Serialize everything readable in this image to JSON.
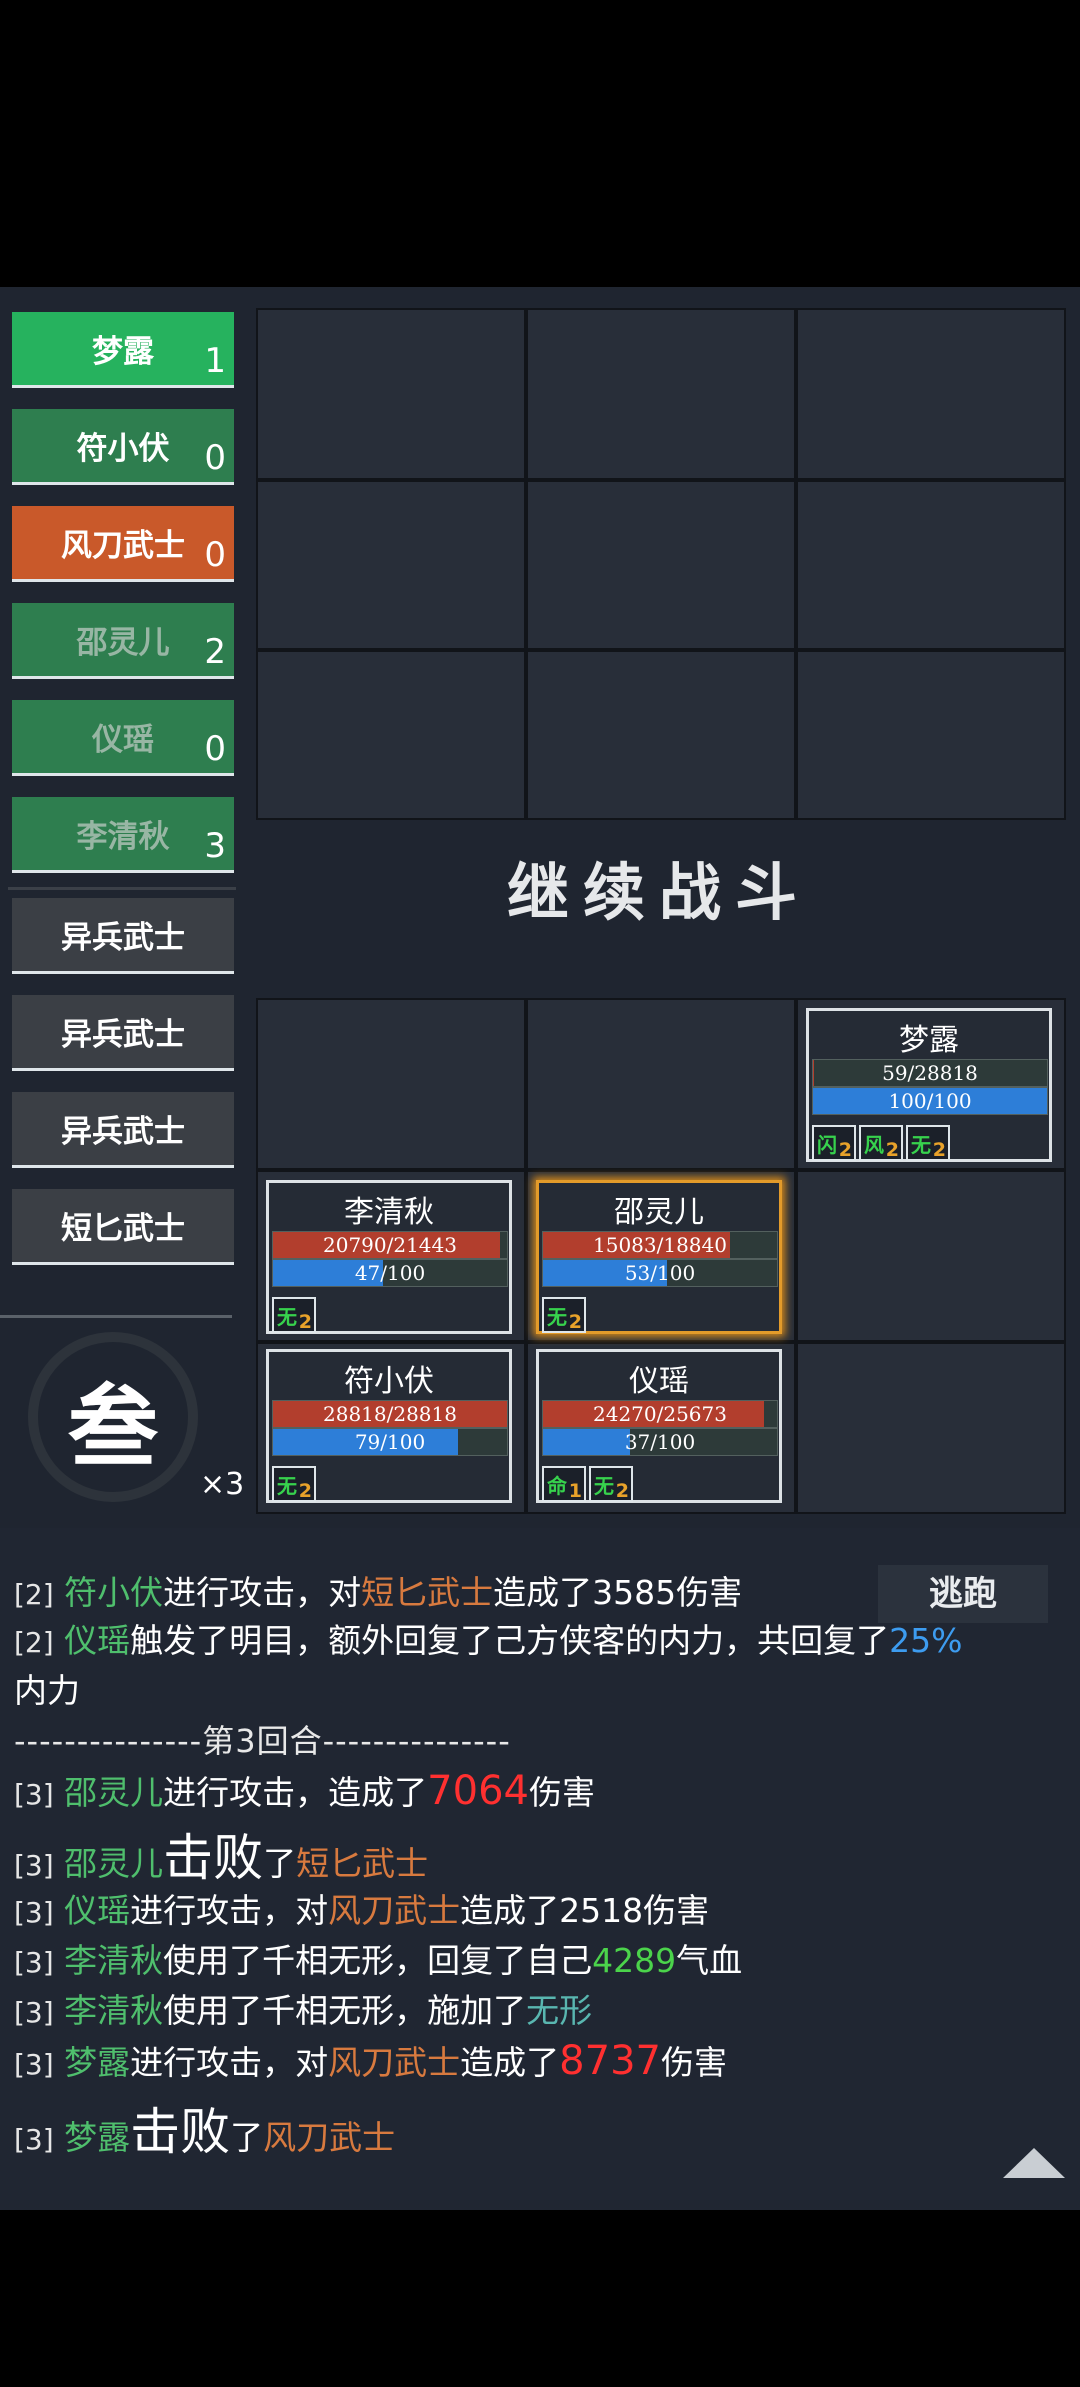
{
  "roster": {
    "allies": [
      {
        "name": "梦露",
        "count": "1"
      },
      {
        "name": "符小伏",
        "count": "0"
      },
      {
        "name": "风刀武士",
        "count": "0"
      },
      {
        "name": "邵灵儿",
        "count": "2"
      },
      {
        "name": "仪瑶",
        "count": "0"
      },
      {
        "name": "李清秋",
        "count": "3"
      }
    ],
    "enemies": [
      {
        "name": "异兵武士"
      },
      {
        "name": "异兵武士"
      },
      {
        "name": "异兵武士"
      },
      {
        "name": "短匕武士"
      }
    ]
  },
  "battle": {
    "continue_label": "继续战斗",
    "units": [
      {
        "name": "梦露",
        "hp": "59/28818",
        "hp_frac": 0.002,
        "mp": "100/100",
        "mp_frac": 1.0,
        "buffs": [
          {
            "glyph": "闪",
            "n": "2"
          },
          {
            "glyph": "风",
            "n": "2"
          },
          {
            "glyph": "无",
            "n": "2"
          }
        ]
      },
      {
        "name": "李清秋",
        "hp": "20790/21443",
        "hp_frac": 0.97,
        "mp": "47/100",
        "mp_frac": 0.47,
        "buffs": [
          {
            "glyph": "无",
            "n": "2"
          }
        ]
      },
      {
        "name": "邵灵儿",
        "hp": "15083/18840",
        "hp_frac": 0.8,
        "mp": "53/100",
        "mp_frac": 0.53,
        "buffs": [
          {
            "glyph": "无",
            "n": "2"
          }
        ]
      },
      {
        "name": "符小伏",
        "hp": "28818/28818",
        "hp_frac": 1.0,
        "mp": "79/100",
        "mp_frac": 0.79,
        "buffs": [
          {
            "glyph": "无",
            "n": "2"
          }
        ]
      },
      {
        "name": "仪瑶",
        "hp": "24270/25673",
        "hp_frac": 0.945,
        "mp": "37/100",
        "mp_frac": 0.37,
        "buffs": [
          {
            "glyph": "命",
            "n": "1"
          },
          {
            "glyph": "无",
            "n": "2"
          }
        ]
      }
    ]
  },
  "round": {
    "glyph": "叁",
    "speed": "×3"
  },
  "escape_label": "逃跑",
  "log": {
    "l1": {
      "tag": "[2]",
      "a": "符小伏",
      "b": "进行攻击，对",
      "c": "短匕武士",
      "d": "造成了3585伤害"
    },
    "l2": {
      "tag": "[2]",
      "a": "仪瑶",
      "b": "触发了明目，额外回复了己方侠客的内力，共回复了",
      "c": "25%"
    },
    "l2b": "内力",
    "divider": "---------------第3回合---------------",
    "l3": {
      "tag": "[3]",
      "a": "邵灵儿",
      "b": "进行攻击，造成了",
      "c": "7064",
      "d": "伤害"
    },
    "l4": {
      "tag": "[3]",
      "a": "邵灵儿",
      "b": "击败",
      "c": "了",
      "d": "短匕武士"
    },
    "l5": {
      "tag": "[3]",
      "a": "仪瑶",
      "b": "进行攻击，对",
      "c": "风刀武士",
      "d": "造成了2518伤害"
    },
    "l6": {
      "tag": "[3]",
      "a": "李清秋",
      "b": "使用了千相无形，回复了自己",
      "c": "4289",
      "d": "气血"
    },
    "l7": {
      "tag": "[3]",
      "a": "李清秋",
      "b": "使用了千相无形，施加了",
      "c": "无形"
    },
    "l8": {
      "tag": "[3]",
      "a": "梦露",
      "b": "进行攻击，对",
      "c": "风刀武士",
      "d": "造成了",
      "e": "8737",
      "f": "伤害"
    },
    "l9": {
      "tag": "[3]",
      "a": "梦露",
      "b": "击败",
      "c": "了",
      "d": "风刀武士"
    }
  }
}
